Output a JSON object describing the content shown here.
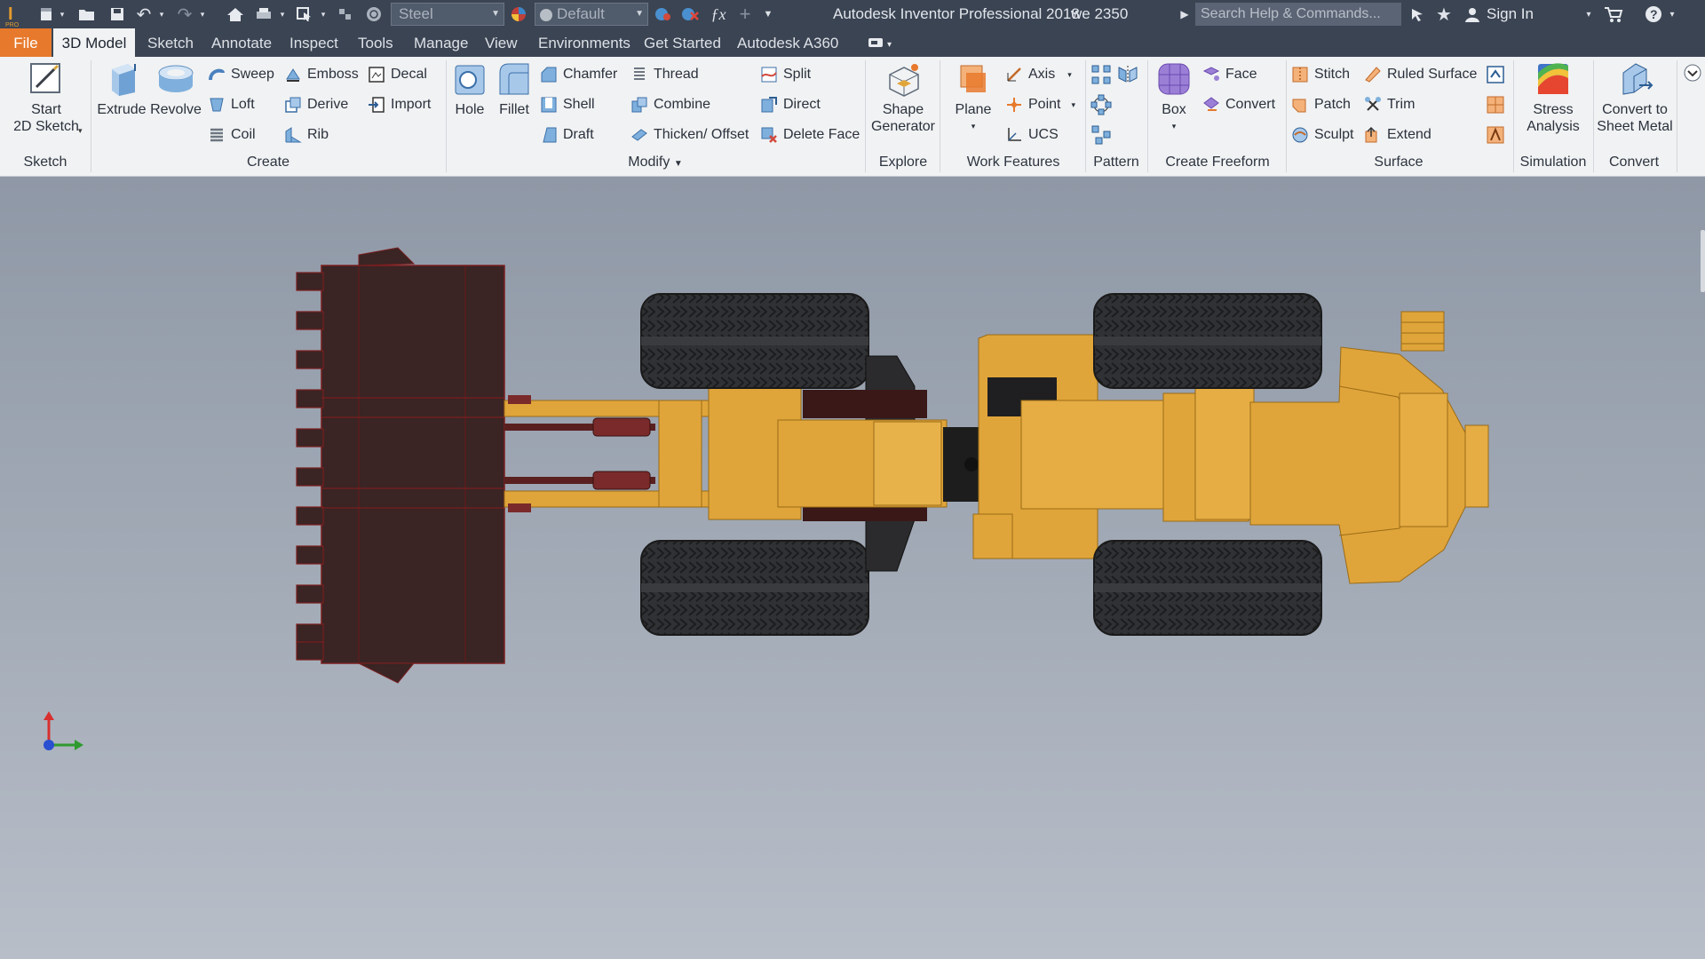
{
  "titlebar": {
    "material": "Steel",
    "appearance": "Default",
    "app_title": "Autodesk Inventor Professional 2018",
    "document": "we 2350",
    "search_placeholder": "Search Help & Commands...",
    "sign_in": "Sign In"
  },
  "tabs": [
    "File",
    "3D Model",
    "Sketch",
    "Annotate",
    "Inspect",
    "Tools",
    "Manage",
    "View",
    "Environments",
    "Get Started",
    "Autodesk A360"
  ],
  "ribbon": {
    "sketch": {
      "title": "Sketch",
      "start_sketch": "Start",
      "start_sketch_2": "2D Sketch"
    },
    "create": {
      "title": "Create",
      "extrude": "Extrude",
      "revolve": "Revolve",
      "sweep": "Sweep",
      "loft": "Loft",
      "coil": "Coil",
      "emboss": "Emboss",
      "derive": "Derive",
      "rib": "Rib",
      "decal": "Decal",
      "import": "Import"
    },
    "modify": {
      "title": "Modify",
      "hole": "Hole",
      "fillet": "Fillet",
      "chamfer": "Chamfer",
      "shell": "Shell",
      "draft": "Draft",
      "thread": "Thread",
      "combine": "Combine",
      "thicken": "Thicken/ Offset",
      "split": "Split",
      "direct": "Direct",
      "delete_face": "Delete Face"
    },
    "explore": {
      "title": "Explore",
      "shape_generator": "Shape",
      "shape_generator_2": "Generator"
    },
    "work_features": {
      "title": "Work Features",
      "plane": "Plane",
      "axis": "Axis",
      "point": "Point",
      "ucs": "UCS"
    },
    "pattern": {
      "title": "Pattern"
    },
    "freeform": {
      "title": "Create Freeform",
      "box": "Box",
      "face": "Face",
      "convert": "Convert"
    },
    "surface": {
      "title": "Surface",
      "stitch": "Stitch",
      "patch": "Patch",
      "sculpt": "Sculpt",
      "ruled_surface": "Ruled Surface",
      "trim": "Trim",
      "extend": "Extend"
    },
    "simulation": {
      "title": "Simulation",
      "stress": "Stress",
      "stress_2": "Analysis"
    },
    "convert": {
      "title": "Convert",
      "sheet_metal": "Convert to",
      "sheet_metal_2": "Sheet Metal"
    }
  },
  "colors": {
    "body_yellow": "#e0a53a",
    "tire_dark": "#2f3032",
    "bucket_dark": "#3a2222",
    "edge_red": "#8a1c1c",
    "file_tab": "#e7792c"
  }
}
